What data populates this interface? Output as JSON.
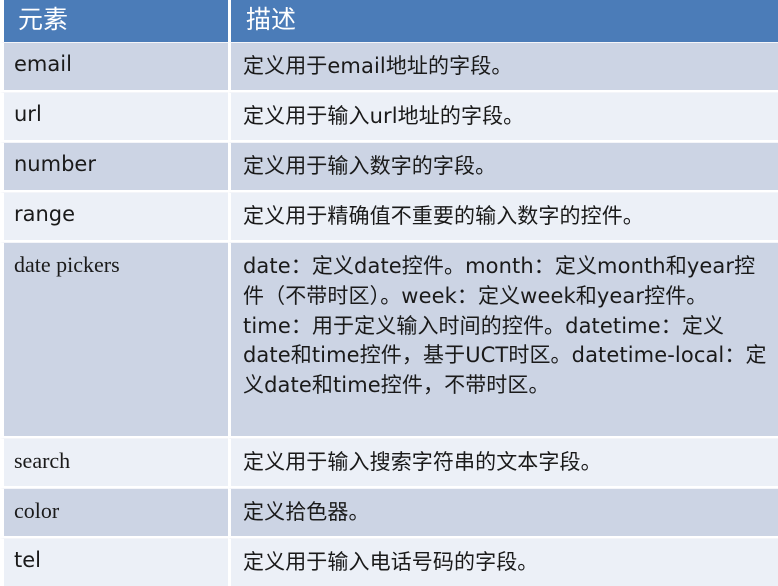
{
  "table": {
    "headers": {
      "element": "元素",
      "description": "描述"
    },
    "rows": [
      {
        "element": "email",
        "description": "定义用于email地址的字段。"
      },
      {
        "element": "url",
        "description": "定义用于输入url地址的字段。"
      },
      {
        "element": "number",
        "description": "定义用于输入数字的字段。"
      },
      {
        "element": "range",
        "description": "定义用于精确值不重要的输入数字的控件。"
      },
      {
        "element": "date pickers",
        "description": "date：定义date控件。month：定义month和year控件（不带时区）。week：定义week和year控件。time：用于定义输入时间的控件。datetime：定义date和time控件，基于UCT时区。datetime-local：定义date和time控件，不带时区。"
      },
      {
        "element": "search",
        "description": "定义用于输入搜索字符串的文本字段。"
      },
      {
        "element": "color",
        "description": "定义拾色器。"
      },
      {
        "element": "tel",
        "description": "定义用于输入电话号码的字段。"
      }
    ]
  },
  "colors": {
    "header_background": "#4b7cb8",
    "header_text": "#ffffff",
    "row_shade_dark": "#ccd4e4",
    "row_shade_light": "#ecf0f7",
    "grid_line": "#ffffff",
    "body_text": "#1a1a1a"
  }
}
